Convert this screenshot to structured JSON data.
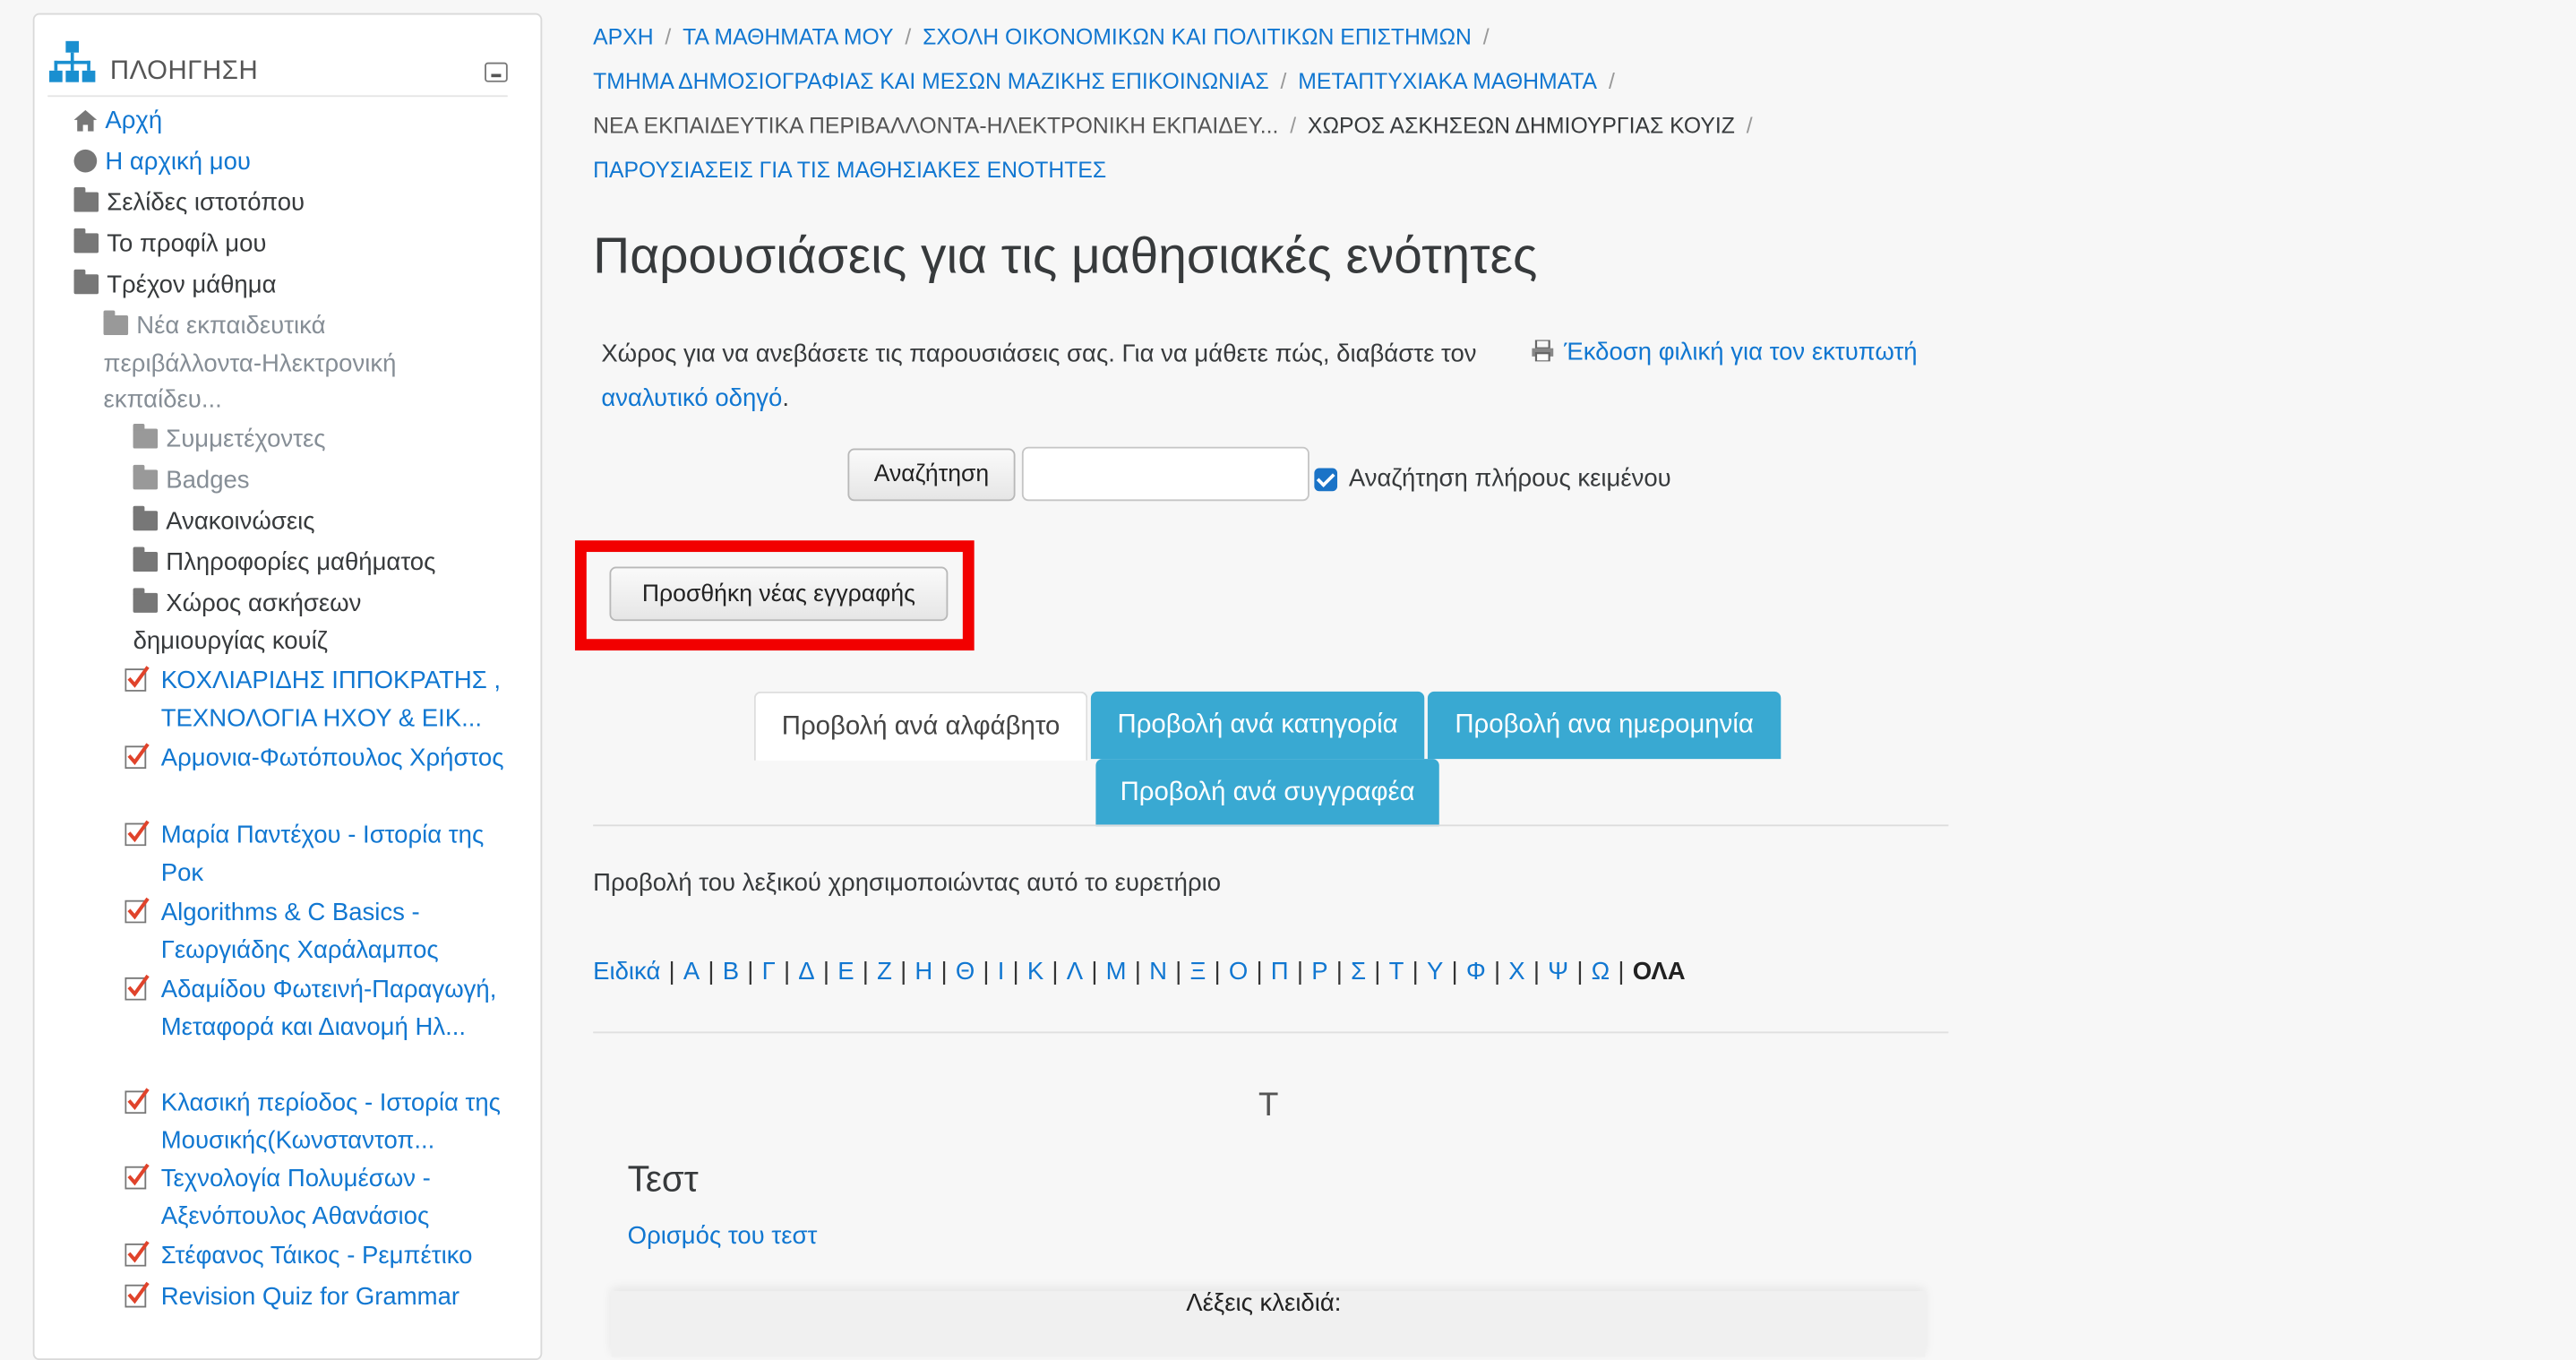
{
  "nav": {
    "title": "ΠΛΟΗΓΗΣΗ",
    "items": [
      {
        "label": "Αρχή",
        "icon": "home-icon"
      },
      {
        "label": "Η αρχική μου",
        "icon": "circle-icon"
      },
      {
        "label": "Σελίδες ιστοτόπου",
        "icon": "folder-icon"
      },
      {
        "label": "Το προφίλ μου",
        "icon": "folder-icon"
      },
      {
        "label": "Τρέχον μάθημα",
        "icon": "folder-icon"
      }
    ],
    "course": "Νέα εκπαιδευτικά περιβάλλοντα-Ηλεκτρονική εκπαίδευ...",
    "course_items": [
      "Συμμετέχοντες",
      "Badges",
      "Ανακοινώσεις",
      "Πληροφορίες μαθήματος"
    ],
    "quiz_area": "Χώρος ασκήσεων δημιουργίας κουίζ",
    "quizzes": [
      "ΚΟΧΛΙΑΡΙΔΗΣ ΙΠΠΟΚΡΑΤΗΣ , ΤΕΧΝΟΛΟΓΙΑ ΗΧΟΥ & ΕΙΚ...",
      "Αρμονια-Φωτόπουλος Χρήστος",
      "Μαρία Παντέχου - Ιστορία της Ροκ",
      "Algorithms & C Basics - Γεωργιάδης Χαράλαμπος",
      "Αδαμίδου Φωτεινή-Παραγωγή, Μεταφορά και Διανομή Ηλ...",
      "Κλασική περίοδος - Ιστορία της Μουσικής(Κωνσταντοπ...",
      "Τεχνολογία Πολυμέσων - Αξενόπουλος Αθανάσιος",
      "Στέφανος Τάικος - Ρεμπέτικο",
      "Revision Quiz for Grammar"
    ]
  },
  "breadcrumb": {
    "home": "ΑΡΧΗ",
    "my_courses": "ΤΑ ΜΑΘΗΜΑΤΑ ΜΟΥ",
    "school": "ΣΧΟΛΗ ΟΙΚΟΝΟΜΙΚΩΝ ΚΑΙ ΠΟΛΙΤΙΚΩΝ ΕΠΙΣΤΗΜΩΝ",
    "department": "ΤΜΗΜΑ ΔΗΜΟΣΙΟΓΡΑΦΙΑΣ ΚΑΙ ΜΕΣΩΝ ΜΑΖΙΚΗΣ ΕΠΙΚΟΙΝΩΝΙΑΣ",
    "postgrad": "ΜΕΤΑΠΤΥΧΙΑΚΑ ΜΑΘΗΜΑΤΑ",
    "course": "ΝΕΑ ΕΚΠΑΙΔΕΥΤΙΚΑ ΠΕΡΙΒΑΛΛΟΝΤΑ-ΗΛΕΚΤΡΟΝΙΚΗ ΕΚΠΑΙΔΕΥ...",
    "section": "ΧΩΡΟΣ ΑΣΚΗΣΕΩΝ ΔΗΜΙΟΥΡΓΙΑΣ ΚΟΥΙΖ",
    "page": "ΠΑΡΟΥΣΙΑΣΕΙΣ ΓΙΑ ΤΙΣ ΜΑΘΗΣΙΑΚΕΣ ΕΝΟΤΗΤΕΣ"
  },
  "page": {
    "title": "Παρουσιάσεις για τις μαθησιακές ενότητες",
    "intro_text": "Χώρος για να ανεβάσετε τις παρουσιάσεις σας. Για να μάθετε πώς, διαβάστε τον",
    "intro_link": "αναλυτικό οδηγό",
    "intro_end": ".",
    "printer_link": "Έκδοση φιλική για τον εκτυπωτή",
    "search_button": "Αναζήτηση",
    "search_value": "",
    "fulltext_label": "Αναζήτηση πλήρους κειμένου",
    "add_entry_button": "Προσθήκη νέας εγγραφής",
    "tabs": [
      "Προβολή ανά αλφάβητο",
      "Προβολή ανά κατηγορία",
      "Προβολή ανα ημερομηνία",
      "Προβολή ανά συγγραφέα"
    ],
    "index_text": "Προβολή του λεξικού χρησιμοποιώντας αυτό το ευρετήριο",
    "letters": [
      "Ειδικά",
      "Α",
      "Β",
      "Γ",
      "Δ",
      "Ε",
      "Ζ",
      "Η",
      "Θ",
      "Ι",
      "Κ",
      "Λ",
      "Μ",
      "Ν",
      "Ξ",
      "Ο",
      "Π",
      "Ρ",
      "Σ",
      "Τ",
      "Υ",
      "Φ",
      "Χ",
      "Ψ",
      "Ω"
    ],
    "all_label": "ΟΛΑ",
    "current_letter": "Τ",
    "entry_concept": "Τεστ",
    "entry_definition": "Ορισμός του τεστ",
    "keywords_label": "Λέξεις κλειδιά:"
  },
  "colors": {
    "link": "#1177d1",
    "tab_blue": "#39a9d2",
    "highlight": "#f20000"
  }
}
